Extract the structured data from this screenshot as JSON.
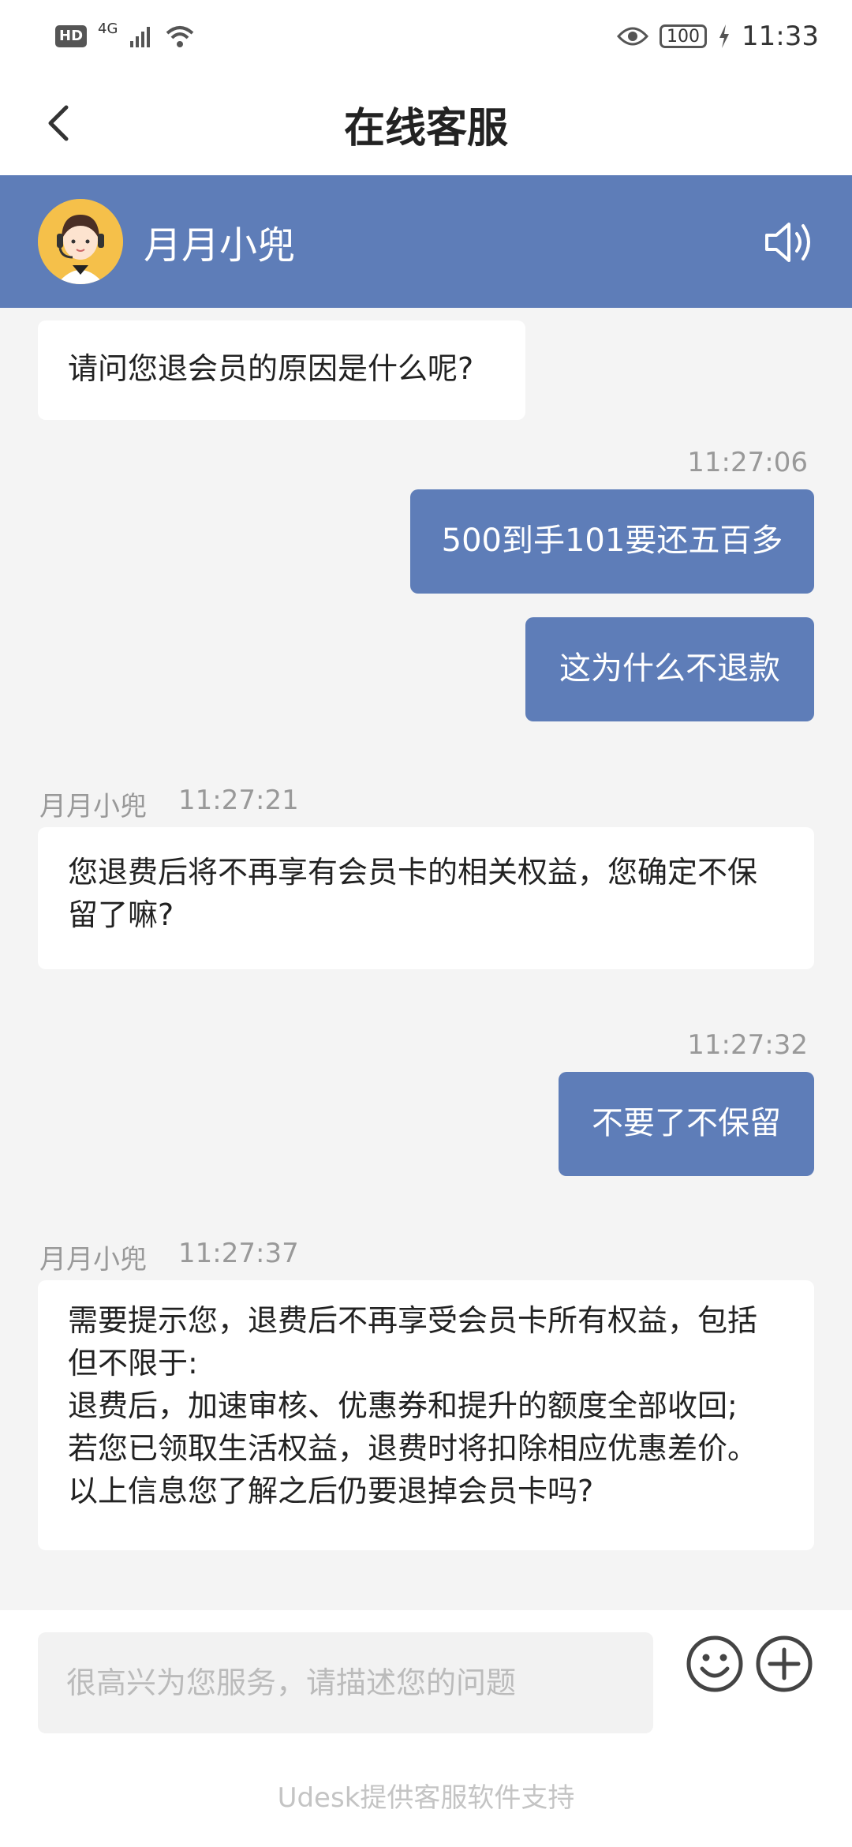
{
  "status_bar": {
    "hd": "HD",
    "network": "4G",
    "battery": "100",
    "time": "11:33"
  },
  "header": {
    "title": "在线客服"
  },
  "agent": {
    "name": "月月小兜"
  },
  "messages": {
    "m1": {
      "text": "请问您退会员的原因是什么呢?"
    },
    "m2": {
      "time": "11:27:06",
      "text": "500到手101要还五百多"
    },
    "m3": {
      "text": "这为什么不退款"
    },
    "m4": {
      "sender": "月月小兜",
      "time": "11:27:21",
      "line1": "您退费后将不再享有会员卡的相关权益，您确定不保",
      "line2": "留了嘛?"
    },
    "m5": {
      "time": "11:27:32",
      "text": "不要了不保留"
    },
    "m6": {
      "sender": "月月小兜",
      "time": "11:27:37",
      "line1": "需要提示您，退费后不再享受会员卡所有权益，包括",
      "line2": "但不限于:",
      "line3": "退费后，加速审核、优惠券和提升的额度全部收回;",
      "line4": "若您已领取生活权益，退费时将扣除相应优惠差价。",
      "line5": "以上信息您了解之后仍要退掉会员卡吗?"
    }
  },
  "input": {
    "placeholder": "很高兴为您服务，请描述您的问题",
    "value": ""
  },
  "footer": {
    "powered_by": "Udesk提供客服软件支持"
  },
  "colors": {
    "accent": "#5e7db8",
    "background": "#f4f4f4"
  }
}
